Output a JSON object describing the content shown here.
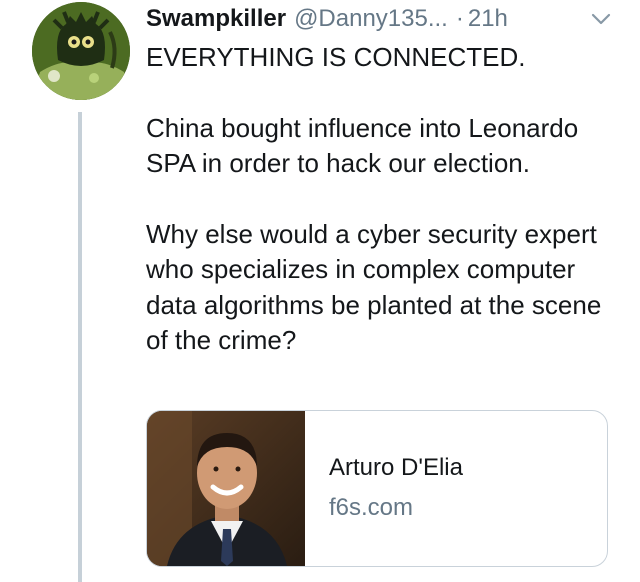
{
  "tweet": {
    "author": {
      "display_name": "Swampkiller",
      "handle": "@Danny135...",
      "avatar_icon": "swamp-monster-avatar"
    },
    "separator": "·",
    "time": "21h",
    "menu_icon": "chevron-down-icon",
    "text_paragraphs": [
      "EVERYTHING IS CONNECTED.",
      "China bought influence into Leonardo SPA in order to hack our election.",
      "Why else would a cyber security expert who specializes in complex computer data algorithms be planted at the scene of the crime?"
    ],
    "link_card": {
      "title": "Arturo D'Elia",
      "domain": "f6s.com",
      "image": "portrait-photo-smiling-man"
    }
  },
  "colors": {
    "text_primary": "#14171a",
    "text_secondary": "#657786",
    "thread_line": "#c6d0d8",
    "card_border": "#c9d2da"
  }
}
